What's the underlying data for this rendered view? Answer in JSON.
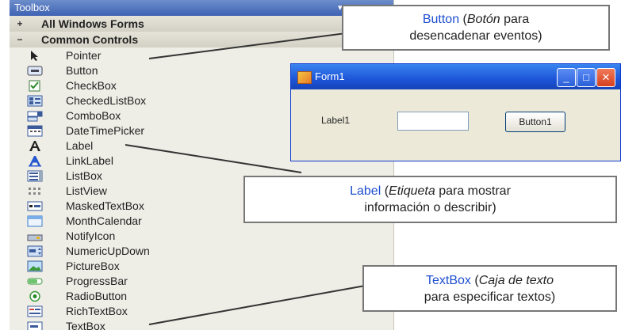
{
  "toolbox": {
    "title": "Toolbox",
    "pin": "▾ ×",
    "groups": [
      {
        "toggle": "+",
        "label": "All Windows Forms"
      },
      {
        "toggle": "−",
        "label": "Common Controls"
      }
    ],
    "items": [
      {
        "label": "Pointer",
        "icon": "pointer-icon"
      },
      {
        "label": "Button",
        "icon": "button-icon"
      },
      {
        "label": "CheckBox",
        "icon": "checkbox-icon"
      },
      {
        "label": "CheckedListBox",
        "icon": "checkedlistbox-icon"
      },
      {
        "label": "ComboBox",
        "icon": "combobox-icon"
      },
      {
        "label": "DateTimePicker",
        "icon": "datetimepicker-icon"
      },
      {
        "label": "Label",
        "icon": "label-icon"
      },
      {
        "label": "LinkLabel",
        "icon": "linklabel-icon"
      },
      {
        "label": "ListBox",
        "icon": "listbox-icon"
      },
      {
        "label": "ListView",
        "icon": "listview-icon"
      },
      {
        "label": "MaskedTextBox",
        "icon": "maskedtextbox-icon"
      },
      {
        "label": "MonthCalendar",
        "icon": "monthcalendar-icon"
      },
      {
        "label": "NotifyIcon",
        "icon": "notifyicon-icon"
      },
      {
        "label": "NumericUpDown",
        "icon": "numericupdown-icon"
      },
      {
        "label": "PictureBox",
        "icon": "picturebox-icon"
      },
      {
        "label": "ProgressBar",
        "icon": "progressbar-icon"
      },
      {
        "label": "RadioButton",
        "icon": "radiobutton-icon"
      },
      {
        "label": "RichTextBox",
        "icon": "richtextbox-icon"
      },
      {
        "label": "TextBox",
        "icon": "textbox-icon"
      }
    ]
  },
  "form": {
    "title": "Form1",
    "label": "Label1",
    "button": "Button1",
    "buttons": {
      "minimize": "_",
      "maximize": "□",
      "close": "✕"
    }
  },
  "callouts": {
    "button": {
      "keyword": "Button",
      "open": " (",
      "italic": "Botón",
      "rest_line1": " para",
      "line2": "desencadenar eventos)"
    },
    "label": {
      "keyword": "Label",
      "open": " (",
      "italic": "Etiqueta",
      "rest_line1": " para mostrar",
      "line2": "información o describir)"
    },
    "textbox": {
      "keyword": "TextBox",
      "open": " (",
      "italic": "Caja de texto",
      "rest_line1": "",
      "line2": "para especificar textos)"
    }
  },
  "colors": {
    "keyword": "#1f4fd1",
    "titlebar": "#3e62b3",
    "form_title": "#1d55d8",
    "close_button": "#d6401d"
  }
}
